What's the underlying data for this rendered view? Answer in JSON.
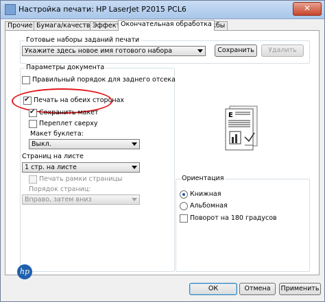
{
  "window": {
    "title": "Настройка печати: HP LaserJet P2015 PCL6",
    "close_symbol": "✕"
  },
  "tabs": [
    {
      "label": "Прочие"
    },
    {
      "label": "Бумага/качество"
    },
    {
      "label": "Эффекты"
    },
    {
      "label": "Окончательная обработка"
    },
    {
      "label": "Службы"
    }
  ],
  "presets": {
    "legend": "Готовые наборы заданий печати",
    "value": "Укажите здесь новое имя готового набора",
    "save_label": "Сохранить",
    "delete_label": "Удалить"
  },
  "document_options": {
    "legend": "Параметры документа",
    "correct_order_label": "Правильный порядок для заднего отсека",
    "correct_order_checked": false,
    "duplex_label": "Печать на обеих сторонах",
    "duplex_checked": true,
    "preserve_layout_label": "Сохранить макет",
    "preserve_layout_checked": true,
    "flip_up_label": "Переплет сверху",
    "flip_up_checked": false,
    "booklet_layout_label": "Макет буклета:",
    "booklet_layout_value": "Выкл.",
    "pages_per_sheet_label": "Страниц на листе",
    "pages_per_sheet_value": "1 стр. на листе",
    "print_borders_label": "Печать рамки страницы",
    "print_borders_checked": false,
    "page_order_label": "Порядок страниц:",
    "page_order_value": "Вправо, затем вниз"
  },
  "orientation": {
    "legend": "Ориентация",
    "portrait_label": "Книжная",
    "landscape_label": "Альбомная",
    "rotate_label": "Поворот на 180 градусов",
    "selected": "portrait",
    "rotate_checked": false
  },
  "preview": {
    "letter": "E"
  },
  "footer": {
    "logo_text": "hp",
    "ok_label": "ОК",
    "cancel_label": "Отмена",
    "apply_label": "Применить"
  },
  "colors": {
    "highlight_oval": "#e0151b",
    "hp_blue": "#1f5fad"
  }
}
